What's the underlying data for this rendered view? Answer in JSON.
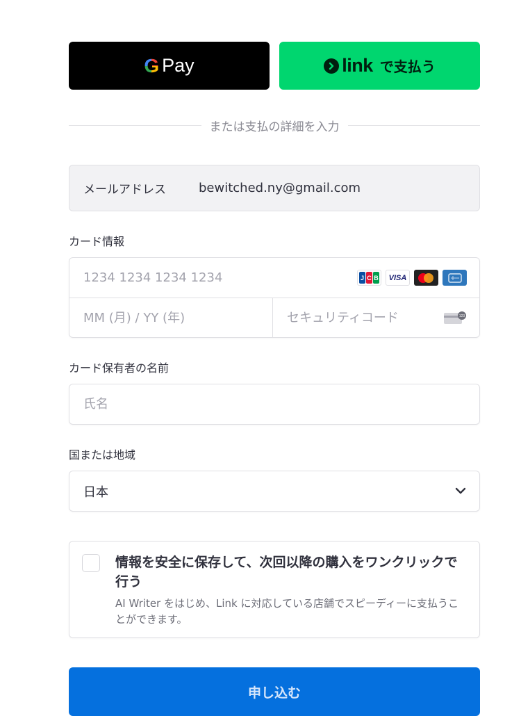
{
  "express": {
    "gpay": {
      "g": "G",
      "label": "Pay"
    },
    "link": {
      "wordmark": "link",
      "label": "で支払う"
    }
  },
  "divider": {
    "text": "または支払の詳細を入力"
  },
  "email": {
    "label": "メールアドレス",
    "value": "bewitched.ny@gmail.com"
  },
  "card": {
    "label": "カード情報",
    "number_placeholder": "1234 1234 1234 1234",
    "expiry_placeholder": "MM (月) / YY (年)",
    "cvc_placeholder": "セキュリティコード",
    "brands": [
      {
        "name": "jcb-icon",
        "text": [
          "J",
          "C",
          "B"
        ]
      },
      {
        "name": "visa-icon",
        "text": "VISA"
      },
      {
        "name": "mastercard-icon",
        "text": ""
      },
      {
        "name": "amex-icon",
        "text": ""
      }
    ]
  },
  "cardholder": {
    "label": "カード保有者の名前",
    "placeholder": "氏名"
  },
  "country": {
    "label": "国または地域",
    "value": "日本"
  },
  "save": {
    "title": "情報を安全に保存して、次回以降の購入をワンクリックで行う",
    "description": "AI Writer をはじめ、Link に対応している店舗でスピーディーに支払うことができます。"
  },
  "submit": {
    "label": "申し込む"
  },
  "colors": {
    "link_green": "#00d66f",
    "submit_blue": "#0570de",
    "gpay_black": "#000000"
  }
}
